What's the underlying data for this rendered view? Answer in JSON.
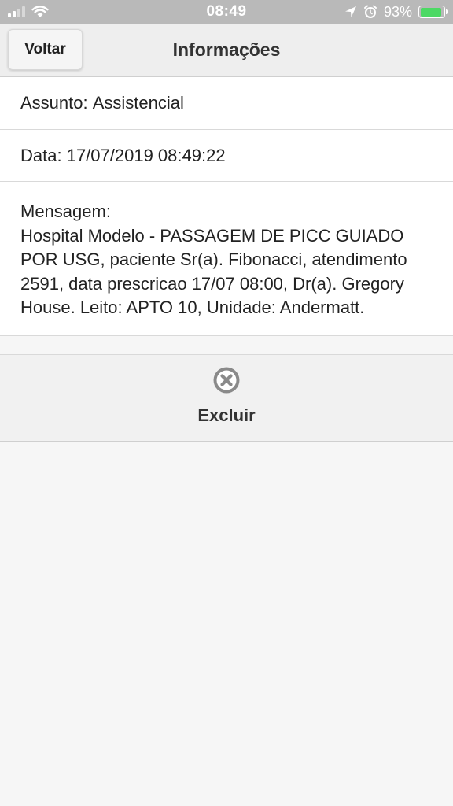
{
  "status_bar": {
    "time": "08:49",
    "battery_percent": "93%",
    "battery_level": 0.93,
    "battery_color": "#4cd964",
    "icons": [
      "signal-icon",
      "wifi-icon",
      "location-arrow-icon",
      "alarm-icon",
      "battery-icon"
    ]
  },
  "header": {
    "back_label": "Voltar",
    "title": "Informações"
  },
  "info": {
    "subject_label": "Assunto: ",
    "subject_value": "Assistencial",
    "date_label": "Data: ",
    "date_value": "17/07/2019 08:49:22",
    "message_label": "Mensagem:",
    "message_text": "Hospital Modelo - PASSAGEM DE PICC GUIADO POR USG, paciente Sr(a). Fibonacci, atendimento 2591, data prescricao 17/07 08:00, Dr(a). Gregory House. Leito: APTO 10, Unidade: Andermatt."
  },
  "actions": {
    "delete_label": "Excluir",
    "delete_icon": "close-circle-icon"
  }
}
